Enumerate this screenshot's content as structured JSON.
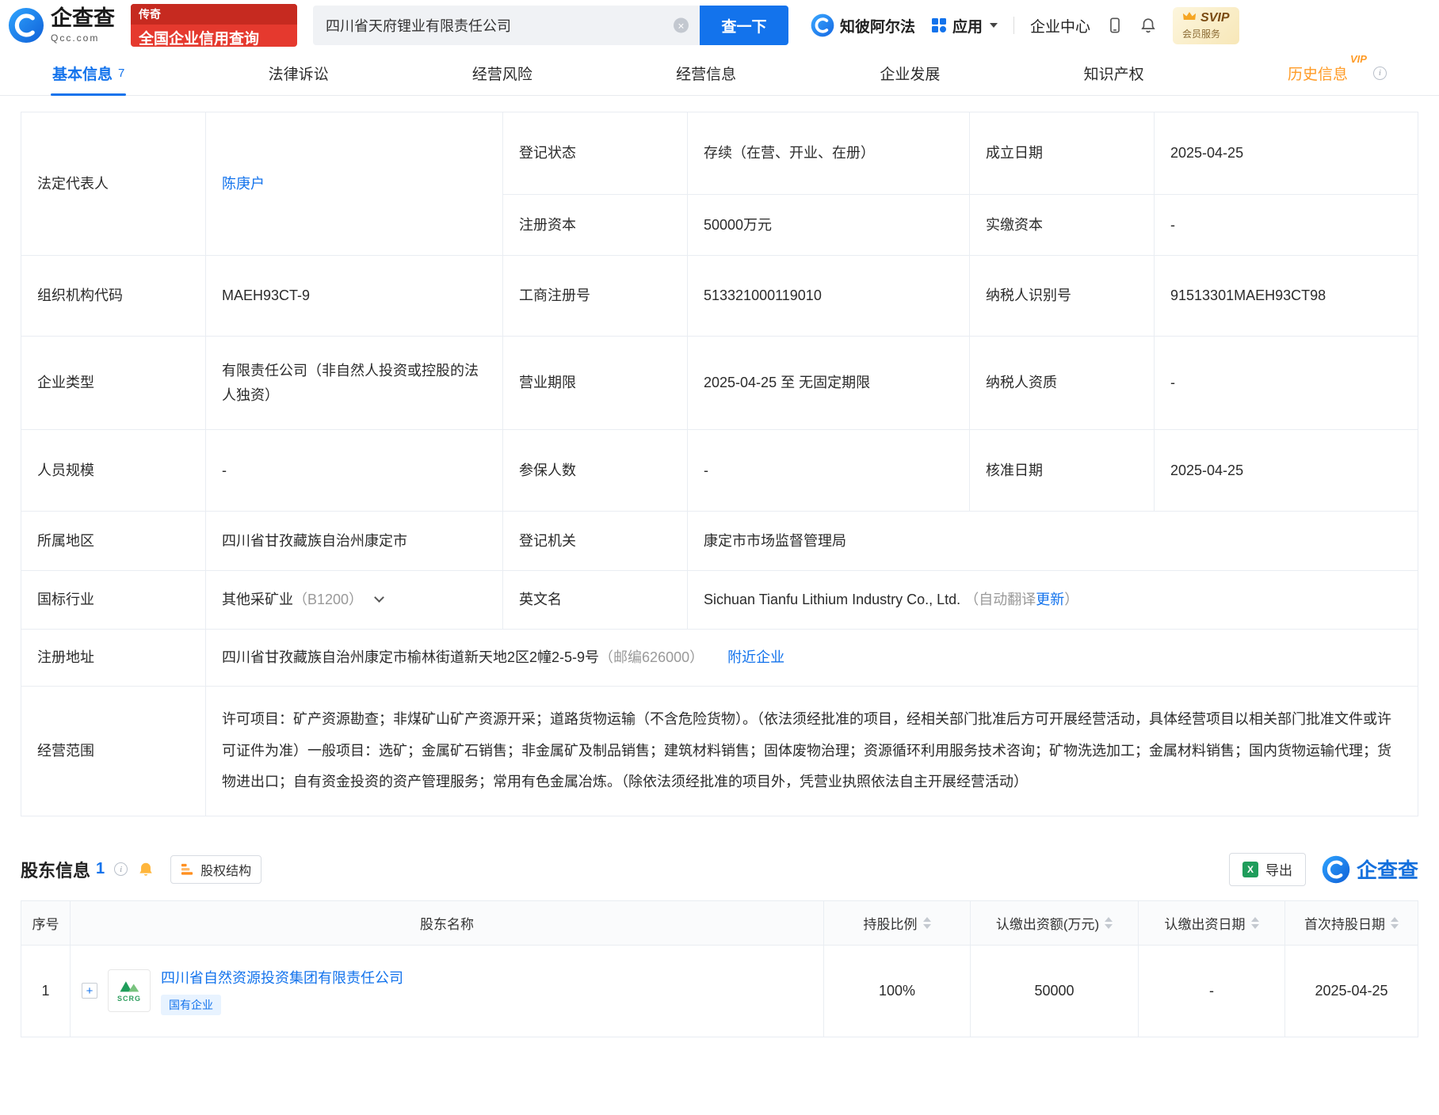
{
  "header": {
    "logo": {
      "name": "企查查",
      "domain": "Qcc.com"
    },
    "promo": {
      "line1": "传奇",
      "line2": "全国企业信用查询"
    },
    "search": {
      "value": "四川省天府锂业有限责任公司",
      "button": "查一下"
    },
    "nav": {
      "zhibi": "知彼阿尔法",
      "apps": "应用",
      "center": "企业中心"
    },
    "svip": {
      "title": "SVIP",
      "subtitle": "会员服务"
    }
  },
  "tabs": [
    {
      "label": "基本信息",
      "count": "7"
    },
    {
      "label": "法律诉讼"
    },
    {
      "label": "经营风险"
    },
    {
      "label": "经营信息"
    },
    {
      "label": "企业发展"
    },
    {
      "label": "知识产权"
    },
    {
      "label": "历史信息",
      "badge": "VIP"
    }
  ],
  "basic": {
    "legal_rep": {
      "label": "法定代表人",
      "value": "陈庚户"
    },
    "reg_status": {
      "label": "登记状态",
      "value": "存续（在营、开业、在册）"
    },
    "est_date": {
      "label": "成立日期",
      "value": "2025-04-25"
    },
    "reg_capital": {
      "label": "注册资本",
      "value": "50000万元"
    },
    "paid_capital": {
      "label": "实缴资本",
      "value": "-"
    },
    "org_code": {
      "label": "组织机构代码",
      "value": "MAEH93CT-9"
    },
    "biz_reg_no": {
      "label": "工商注册号",
      "value": "513321000119010"
    },
    "tax_id": {
      "label": "纳税人识别号",
      "value": "91513301MAEH93CT98"
    },
    "company_type": {
      "label": "企业类型",
      "value": "有限责任公司（非自然人投资或控股的法人独资）"
    },
    "biz_term": {
      "label": "营业期限",
      "value": "2025-04-25 至 无固定期限"
    },
    "taxpayer_qual": {
      "label": "纳税人资质",
      "value": "-"
    },
    "staff_size": {
      "label": "人员规模",
      "value": "-"
    },
    "insured_count": {
      "label": "参保人数",
      "value": "-"
    },
    "approval_date": {
      "label": "核准日期",
      "value": "2025-04-25"
    },
    "region": {
      "label": "所属地区",
      "value": "四川省甘孜藏族自治州康定市"
    },
    "reg_authority": {
      "label": "登记机关",
      "value": "康定市市场监督管理局"
    },
    "industry": {
      "label": "国标行业",
      "value": "其他采矿业",
      "code": "（B1200）"
    },
    "en_name": {
      "label": "英文名",
      "value": "Sichuan Tianfu Lithium Industry Co., Ltd.",
      "note_prefix": "（自动翻译",
      "note_link": "更新",
      "note_suffix": "）"
    },
    "address": {
      "label": "注册地址",
      "value": "四川省甘孜藏族自治州康定市榆林街道新天地2区2幢2-5-9号",
      "postcode": "（邮编626000）",
      "nearby_link": "附近企业"
    },
    "scope": {
      "label": "经营范围",
      "value": "许可项目：矿产资源勘查；非煤矿山矿产资源开采；道路货物运输（不含危险货物）。（依法须经批准的项目，经相关部门批准后方可开展经营活动，具体经营项目以相关部门批准文件或许可证件为准）一般项目：选矿；金属矿石销售；非金属矿及制品销售；建筑材料销售；固体废物治理；资源循环利用服务技术咨询；矿物洗选加工；金属材料销售；国内货物运输代理；货物进出口；自有资金投资的资产管理服务；常用有色金属冶炼。（除依法须经批准的项目外，凭营业执照依法自主开展经营活动）"
    }
  },
  "shareholders": {
    "title": "股东信息",
    "count": "1",
    "equity_button": "股权结构",
    "export_button": "导出",
    "brand": "企查查",
    "columns": {
      "index": "序号",
      "name": "股东名称",
      "ratio": "持股比例",
      "amount": "认缴出资额(万元)",
      "date": "认缴出资日期",
      "first_date": "首次持股日期"
    },
    "rows": [
      {
        "index": "1",
        "name": "四川省自然资源投资集团有限责任公司",
        "tag": "国有企业",
        "logo_text": "SCRG",
        "ratio": "100%",
        "amount": "50000",
        "date": "-",
        "first_date": "2025-04-25"
      }
    ]
  }
}
